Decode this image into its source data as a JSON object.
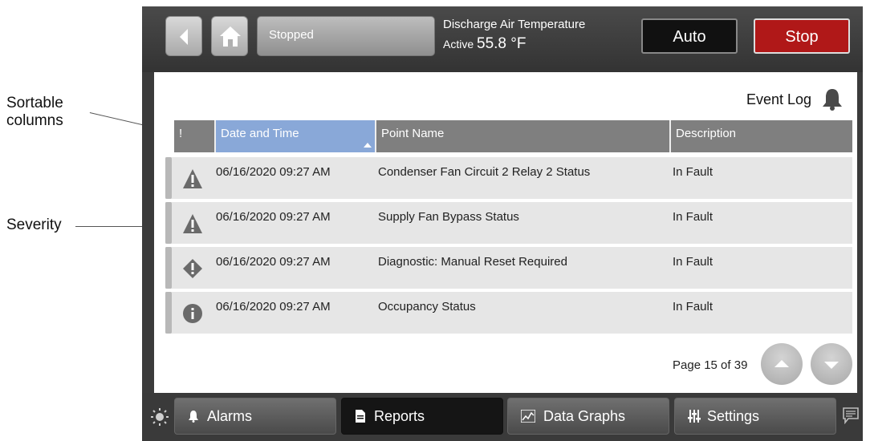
{
  "annotations": {
    "sortable": "Sortable\ncolumns",
    "severity": "Severity"
  },
  "header": {
    "status": "Stopped",
    "dat_label": "Discharge Air Temperature",
    "dat_state": "Active",
    "dat_value": "55.8 °F",
    "auto_label": "Auto",
    "stop_label": "Stop"
  },
  "event_log": {
    "title": "Event Log",
    "columns": [
      "!",
      "Date and Time",
      "Point Name",
      "Description"
    ],
    "sorted_column": "Date and Time",
    "rows": [
      {
        "severity": "warning-triangle-icon",
        "datetime": "06/16/2020 09:27 AM",
        "point": "Condenser Fan Circuit 2 Relay 2 Status",
        "description": "In Fault"
      },
      {
        "severity": "warning-triangle-icon",
        "datetime": "06/16/2020 09:27 AM",
        "point": "Supply Fan Bypass Status",
        "description": "In Fault"
      },
      {
        "severity": "diamond-alert-icon",
        "datetime": "06/16/2020 09:27 AM",
        "point": "Diagnostic: Manual Reset Required",
        "description": "In Fault"
      },
      {
        "severity": "info-circle-icon",
        "datetime": "06/16/2020 09:27 AM",
        "point": "Occupancy Status",
        "description": "In Fault"
      }
    ],
    "page_text": "Page 15 of 39"
  },
  "nav": {
    "tabs": [
      {
        "label": "Alarms",
        "icon": "bell-icon"
      },
      {
        "label": "Reports",
        "icon": "document-icon"
      },
      {
        "label": "Data Graphs",
        "icon": "graph-icon"
      },
      {
        "label": "Settings",
        "icon": "sliders-icon"
      }
    ],
    "active_tab": "Reports"
  },
  "colors": {
    "stop": "#b01818",
    "sorted_header": "#89a8d8"
  }
}
